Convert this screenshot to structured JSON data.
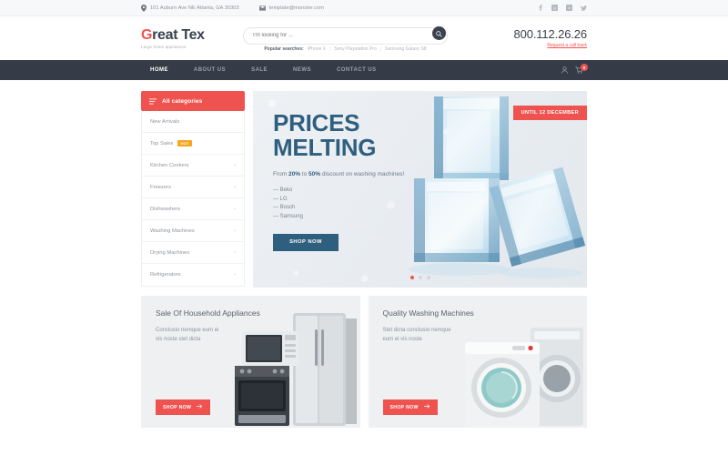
{
  "topbar": {
    "address": "101 Auburn Ave NE Atlanta, GA 30303",
    "email": "template@monster.com",
    "location_icon": "map-pin-icon",
    "mail_icon": "envelope-icon",
    "social": [
      {
        "name": "facebook-icon",
        "glyph": "f"
      },
      {
        "name": "google-plus-icon",
        "glyph": "G"
      },
      {
        "name": "behance-icon",
        "glyph": "B"
      },
      {
        "name": "twitter-icon",
        "glyph": "t"
      }
    ]
  },
  "header": {
    "logo_first": "G",
    "logo_rest": "reat Tex",
    "tagline": "Large home appliances",
    "search": {
      "placeholder": "I'm looking for ...",
      "value": "",
      "button_icon": "search-icon"
    },
    "popular_label": "Popular searches:",
    "popular_items": [
      "iPhone X",
      "Sony Playstation Pro",
      "Samsung Galaxy S8"
    ],
    "phone": "800.112.26.26",
    "callback": "Request a call back"
  },
  "nav": {
    "items": [
      {
        "label": "HOME",
        "active": true
      },
      {
        "label": "ABOUT US",
        "active": false
      },
      {
        "label": "SALE",
        "active": false
      },
      {
        "label": "NEWS",
        "active": false
      },
      {
        "label": "CONTACT US",
        "active": false
      }
    ],
    "account_icon": "user-icon",
    "cart_icon": "cart-icon",
    "cart_count": "0"
  },
  "sidebar": {
    "header_label": "All categories",
    "header_icon": "hamburger-icon",
    "items": [
      {
        "label": "New Arrivals",
        "badge": "",
        "chevron": false
      },
      {
        "label": "Top Sales",
        "badge": "HOT",
        "chevron": false
      },
      {
        "label": "Kitchen Cookers",
        "badge": "",
        "chevron": true
      },
      {
        "label": "Freezers",
        "badge": "",
        "chevron": true
      },
      {
        "label": "Dishwashers",
        "badge": "",
        "chevron": true
      },
      {
        "label": "Washing Machines",
        "badge": "",
        "chevron": true
      },
      {
        "label": "Drying Machines",
        "badge": "",
        "chevron": true
      },
      {
        "label": "Refrigerators",
        "badge": "",
        "chevron": true
      }
    ]
  },
  "hero": {
    "badge": "UNTIL 12 DECEMBER",
    "title_line1": "PRICES",
    "title_line2": "MELTING",
    "subtitle_pre": "From ",
    "subtitle_b1": "20%",
    "subtitle_mid": " to ",
    "subtitle_b2": "50%",
    "subtitle_post": " discount on washing machines!",
    "brands": [
      "— Beko",
      "— LG",
      "— Bosch",
      "— Samsung"
    ],
    "cta": "SHOP NOW",
    "slides": 3,
    "active_slide": 1
  },
  "promos": [
    {
      "title": "Sale Of Household Appliances",
      "desc_line1": "Conclusio nemque eum ei",
      "desc_line2": "vis noste stet dicta",
      "cta": "SHOP NOW",
      "cta_icon": "arrow-right-icon",
      "image": "microwave-and-fridge-image"
    },
    {
      "title": "Quality Washing Machines",
      "desc_line1": "Stet dicta conclusio nemque",
      "desc_line2": "eum ei vis noste",
      "cta": "SHOP NOW",
      "cta_icon": "arrow-right-icon",
      "image": "washing-machine-image"
    }
  ],
  "colors": {
    "accent_red": "#ef5350",
    "dark_navy": "#353c47",
    "hero_blue": "#2f5f7f",
    "hot_orange": "#f5a623"
  }
}
